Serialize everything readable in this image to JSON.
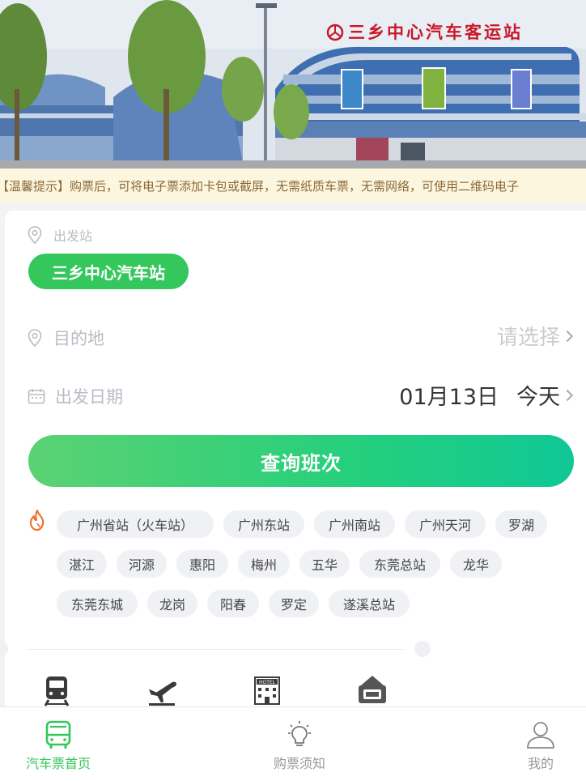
{
  "hero": {
    "station_sign": "三乡中心汽车客运站"
  },
  "notice": {
    "text": "【温馨提示】购票后，可将电子票添加卡包或截屏，无需纸质车票，无需网络，可使用二维码电子"
  },
  "search": {
    "origin_label": "出发站",
    "origin_value": "三乡中心汽车站",
    "destination_label": "目的地",
    "destination_placeholder": "请选择",
    "date_label": "出发日期",
    "date_value": "01月13日",
    "date_relative": "今天",
    "button_label": "查询班次"
  },
  "hot_destinations": [
    "广州省站（火车站）",
    "广州东站",
    "广州南站",
    "广州天河",
    "罗湖",
    "湛江",
    "河源",
    "惠阳",
    "梅州",
    "五华",
    "东莞总站",
    "龙华",
    "东莞东城",
    "龙岗",
    "阳春",
    "罗定",
    "遂溪总站"
  ],
  "services": [
    {
      "icon": "train-icon"
    },
    {
      "icon": "airplane-icon"
    },
    {
      "icon": "hotel-icon"
    },
    {
      "icon": "ticket-icon"
    }
  ],
  "tabbar": {
    "items": [
      {
        "label": "汽车票首页",
        "icon": "bus-icon",
        "active": true
      },
      {
        "label": "购票须知",
        "icon": "lightbulb-icon",
        "active": false
      },
      {
        "label": "我的",
        "icon": "user-icon",
        "active": false
      }
    ]
  },
  "colors": {
    "accent": "#34c75c",
    "notice_bg": "#fdf6df",
    "notice_text": "#8a6a3a",
    "placeholder": "#b8bcc3"
  }
}
